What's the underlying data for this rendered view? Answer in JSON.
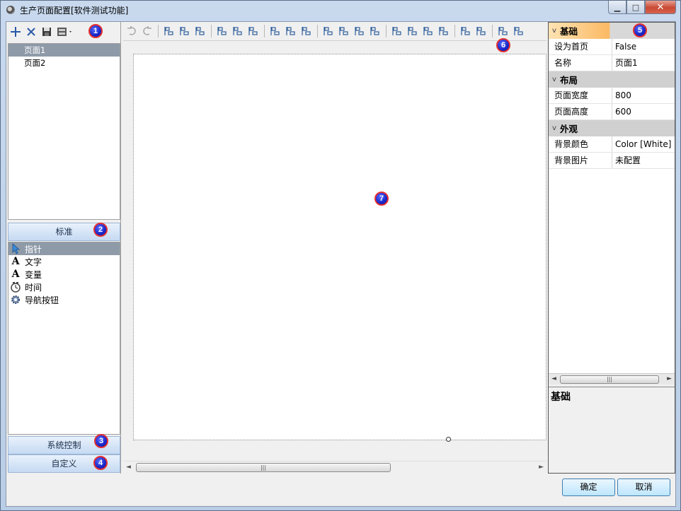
{
  "window": {
    "title": "生产页面配置[软件测试功能]",
    "min_label": "▁",
    "max_label": "□",
    "close_label": "✕"
  },
  "pages": [
    {
      "label": "页面1",
      "selected": true
    },
    {
      "label": "页面2",
      "selected": false
    }
  ],
  "toolbox": {
    "standard_label": "标准",
    "system_label": "系统控制",
    "custom_label": "自定义",
    "items": [
      {
        "label": "指针",
        "icon": "pointer-icon",
        "selected": true
      },
      {
        "label": "文字",
        "icon": "text-icon",
        "selected": false
      },
      {
        "label": "变量",
        "icon": "variable-icon",
        "selected": false
      },
      {
        "label": "时间",
        "icon": "clock-icon",
        "selected": false
      },
      {
        "label": "导航按钮",
        "icon": "gear-icon",
        "selected": false
      }
    ]
  },
  "properties": {
    "categories": [
      {
        "name": "基础",
        "rows": [
          {
            "name": "设为首页",
            "value": "False"
          },
          {
            "name": "名称",
            "value": "页面1"
          }
        ]
      },
      {
        "name": "布局",
        "rows": [
          {
            "name": "页面宽度",
            "value": "800"
          },
          {
            "name": "页面高度",
            "value": "600"
          }
        ]
      },
      {
        "name": "外观",
        "rows": [
          {
            "name": "背景颜色",
            "value": "Color [White]"
          },
          {
            "name": "背景图片",
            "value": "未配置"
          }
        ]
      }
    ],
    "description_title": "基础"
  },
  "buttons": {
    "ok": "确定",
    "cancel": "取消"
  },
  "markers": [
    "1",
    "2",
    "3",
    "4",
    "5",
    "6",
    "7"
  ],
  "colors": {
    "marker_fill": "#1726c8",
    "marker_border": "#e53030",
    "selection": "#8e9aa8"
  }
}
